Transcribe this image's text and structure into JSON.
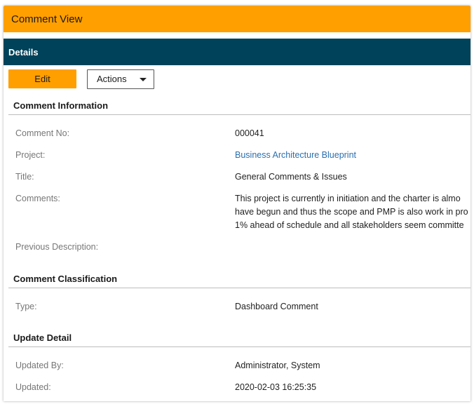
{
  "window": {
    "title": "Comment View"
  },
  "details_bar": {
    "label": "Details"
  },
  "toolbar": {
    "edit_label": "Edit",
    "actions_label": "Actions"
  },
  "sections": {
    "comment_information": {
      "heading": "Comment Information",
      "comment_no_label": "Comment No:",
      "comment_no_value": "000041",
      "project_label": "Project:",
      "project_value": "Business Architecture Blueprint",
      "title_label": "Title:",
      "title_value": "General Comments & Issues",
      "comments_label": "Comments:",
      "comments_lines": [
        "This project is currently in initiation and the charter is almo",
        "have begun and thus the scope and PMP is also work in pro",
        "1% ahead of schedule and all stakeholders seem committe"
      ],
      "previous_description_label": "Previous Description:"
    },
    "comment_classification": {
      "heading": "Comment Classification",
      "type_label": "Type:",
      "type_value": "Dashboard Comment"
    },
    "update_detail": {
      "heading": "Update Detail",
      "updated_by_label": "Updated By:",
      "updated_by_value": "Administrator, System",
      "updated_label": "Updated:",
      "updated_value": "2020-02-03 16:25:35"
    }
  },
  "colors": {
    "accent_orange": "#ff9f00",
    "header_teal": "#00425a",
    "link_blue": "#2a6fb0"
  }
}
